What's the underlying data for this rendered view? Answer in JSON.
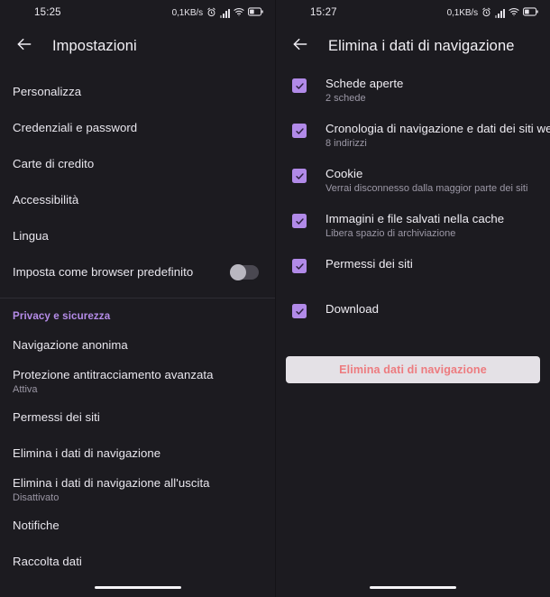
{
  "left": {
    "status": {
      "time": "15:25",
      "network_speed": "0,1KB/s",
      "icons": [
        "alarm-icon",
        "signal-icon",
        "wifi-icon",
        "battery-icon"
      ]
    },
    "appbar": {
      "back_icon": "back-arrow-icon",
      "title": "Impostazioni"
    },
    "items": [
      {
        "title": "Personalizza",
        "sub": "",
        "control": "none"
      },
      {
        "title": "Credenziali e password",
        "sub": "",
        "control": "none"
      },
      {
        "title": "Carte di credito",
        "sub": "",
        "control": "none"
      },
      {
        "title": "Accessibilità",
        "sub": "",
        "control": "none"
      },
      {
        "title": "Lingua",
        "sub": "",
        "control": "none"
      },
      {
        "title": "Imposta come browser predefinito",
        "sub": "",
        "control": "toggle",
        "toggle_on": false
      }
    ],
    "section_header": "Privacy e sicurezza",
    "privacy_items": [
      {
        "title": "Navigazione anonima",
        "sub": ""
      },
      {
        "title": "Protezione antitracciamento avanzata",
        "sub": "Attiva"
      },
      {
        "title": "Permessi dei siti",
        "sub": ""
      },
      {
        "title": "Elimina i dati di navigazione",
        "sub": ""
      },
      {
        "title": "Elimina i dati di navigazione all'uscita",
        "sub": "Disattivato"
      },
      {
        "title": "Notifiche",
        "sub": ""
      },
      {
        "title": "Raccolta dati",
        "sub": ""
      }
    ]
  },
  "right": {
    "status": {
      "time": "15:27",
      "network_speed": "0,1KB/s",
      "icons": [
        "alarm-icon",
        "signal-icon",
        "wifi-icon",
        "battery-icon"
      ]
    },
    "appbar": {
      "back_icon": "back-arrow-icon",
      "title": "Elimina i dati di navigazione"
    },
    "checkboxes": [
      {
        "title": "Schede aperte",
        "sub": "2 schede",
        "checked": true
      },
      {
        "title": "Cronologia di navigazione e dati dei siti web",
        "sub": "8 indirizzi",
        "checked": true
      },
      {
        "title": "Cookie",
        "sub": "Verrai disconnesso dalla maggior parte dei siti",
        "checked": true
      },
      {
        "title": "Immagini e file salvati nella cache",
        "sub": "Libera spazio di archiviazione",
        "checked": true
      },
      {
        "title": "Permessi dei siti",
        "sub": "",
        "checked": true
      },
      {
        "title": "Download",
        "sub": "",
        "checked": true
      }
    ],
    "delete_button": "Elimina dati di navigazione"
  },
  "colors": {
    "background": "#1c1b20",
    "accent_purple": "#b18ae8",
    "section_header": "#b58ce8",
    "danger_text": "#ed7b7f",
    "button_bg": "#e4e1e6",
    "primary_text": "#f0eef4",
    "secondary_text": "#9c98a6"
  }
}
